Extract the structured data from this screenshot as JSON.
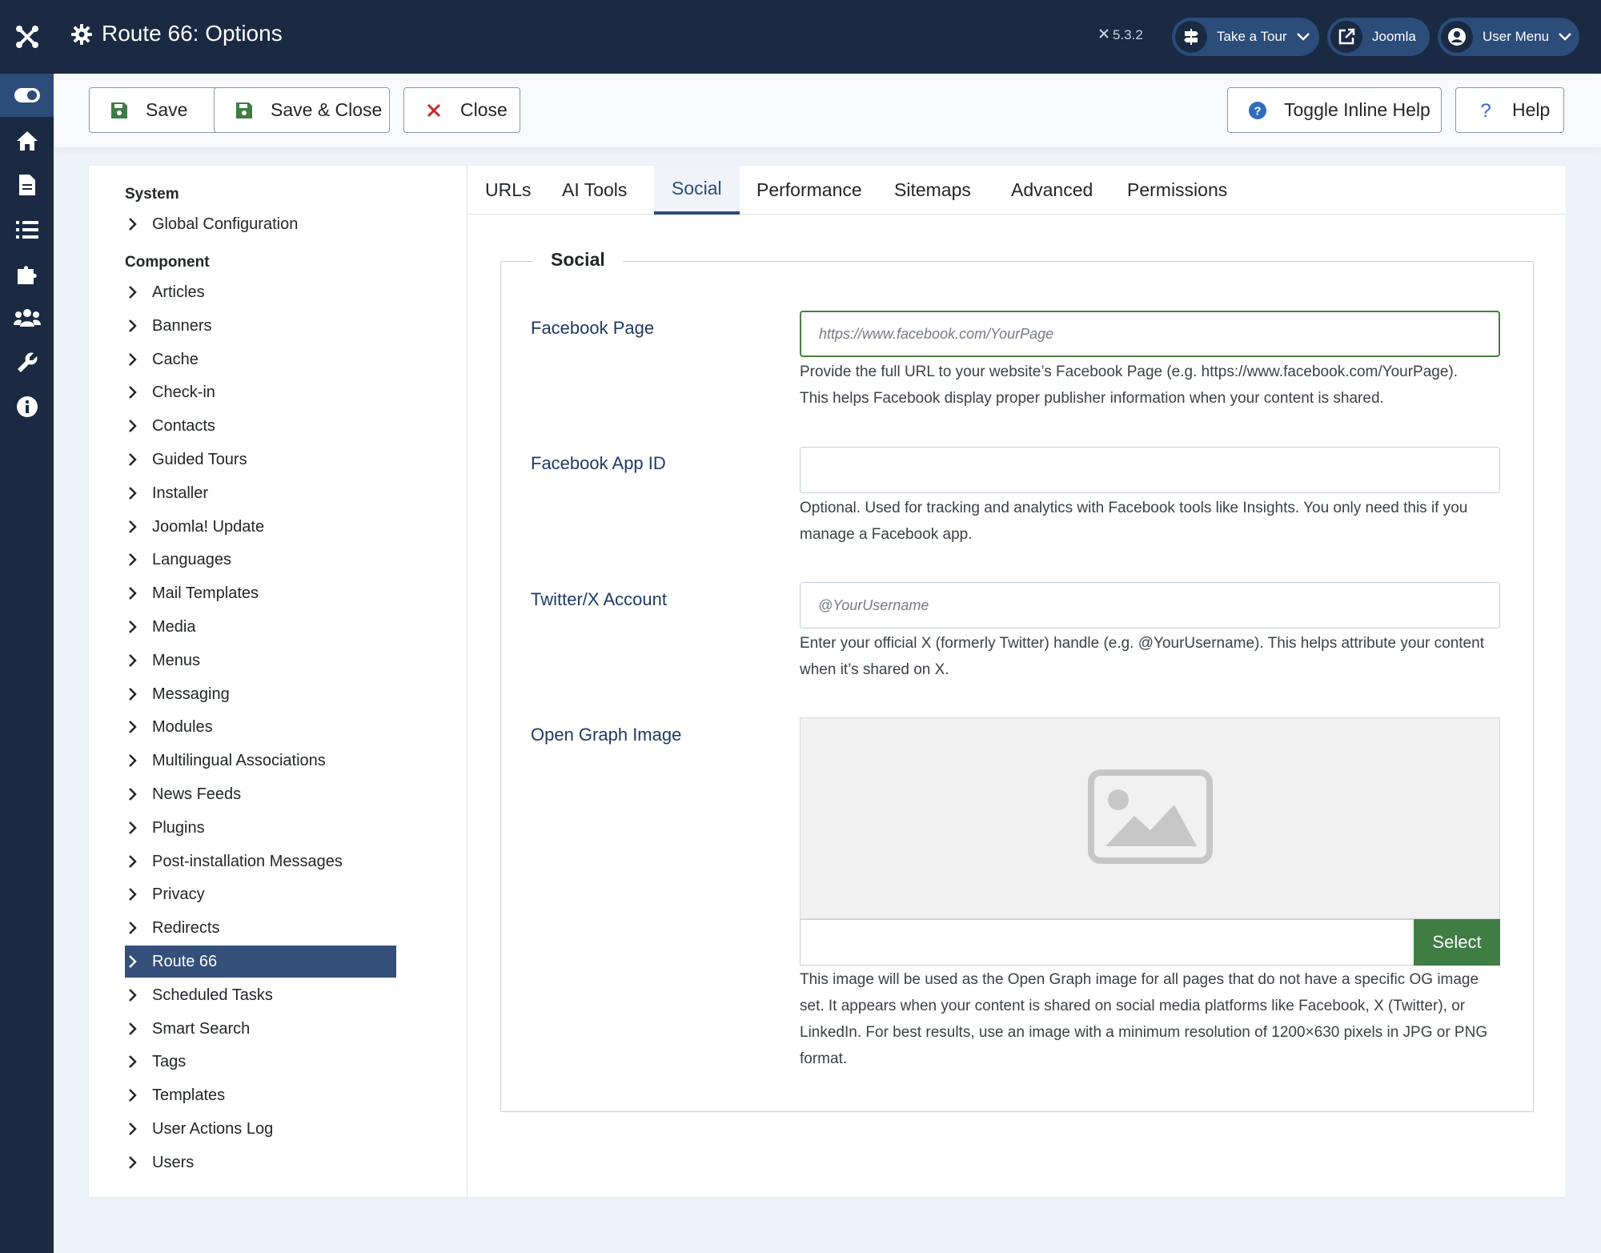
{
  "header": {
    "title": "Route 66: Options",
    "version": "5.3.2",
    "take_tour": "Take a Tour",
    "joomla": "Joomla",
    "user_menu": "User Menu"
  },
  "toolbar": {
    "save": "Save",
    "save_close": "Save & Close",
    "close": "Close",
    "toggle_help": "Toggle Inline Help",
    "help": "Help"
  },
  "sidebar": {
    "system_heading": "System",
    "system_items": [
      "Global Configuration"
    ],
    "component_heading": "Component",
    "items": [
      "Articles",
      "Banners",
      "Cache",
      "Check-in",
      "Contacts",
      "Guided Tours",
      "Installer",
      "Joomla! Update",
      "Languages",
      "Mail Templates",
      "Media",
      "Menus",
      "Messaging",
      "Modules",
      "Multilingual Associations",
      "News Feeds",
      "Plugins",
      "Post-installation Messages",
      "Privacy",
      "Redirects",
      "Route 66",
      "Scheduled Tasks",
      "Smart Search",
      "Tags",
      "Templates",
      "User Actions Log",
      "Users"
    ],
    "active_item": "Route 66"
  },
  "tabs": [
    "URLs",
    "AI Tools",
    "Social",
    "Performance",
    "Sitemaps",
    "Advanced",
    "Permissions"
  ],
  "active_tab": "Social",
  "fieldset": {
    "legend": "Social",
    "facebook_page": {
      "label": "Facebook Page",
      "placeholder": "https://www.facebook.com/YourPage",
      "desc1": "Provide the full URL to your website’s Facebook Page (e.g. https://www.facebook.com/YourPage).",
      "desc2": "This helps Facebook display proper publisher information when your content is shared."
    },
    "facebook_app_id": {
      "label": "Facebook App ID",
      "placeholder": "",
      "desc1": "Optional. Used for tracking and analytics with Facebook tools like Insights. You only need this if you",
      "desc2": "manage a Facebook app."
    },
    "twitter": {
      "label": "Twitter/X Account",
      "placeholder": "@YourUsername",
      "desc1": "Enter your official X (formerly Twitter) handle (e.g. @YourUsername). This helps attribute your content",
      "desc2": "when it’s shared on X."
    },
    "og_image": {
      "label": "Open Graph Image",
      "select": "Select",
      "desc1": "This image will be used as the Open Graph image for all pages that do not have a specific OG image",
      "desc2": "set. It appears when your content is shared on social media platforms like Facebook, X (Twitter), or",
      "desc3": "LinkedIn. For best results, use an image with a minimum resolution of 1200×630 pixels in JPG or PNG",
      "desc4": "format."
    }
  },
  "colors": {
    "header_bg": "#1a2a43",
    "accent": "#2a4d79",
    "active_item_bg": "#334f7a",
    "select_button": "#3f7d45",
    "save_icon": "#3f7d45",
    "close_icon": "#c52827",
    "help_icon": "#2f6bc1"
  },
  "icons": {
    "rail": [
      "joomla-logo-icon",
      "toggle-menu-icon",
      "home-icon",
      "file-icon",
      "list-icon",
      "puzzle-icon",
      "users-icon",
      "wrench-icon",
      "info-icon"
    ]
  }
}
